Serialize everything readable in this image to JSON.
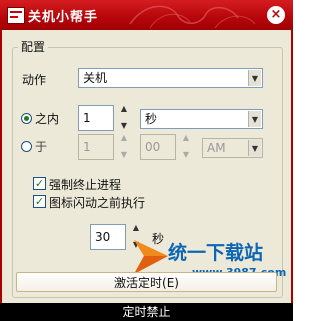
{
  "window": {
    "title": "关机小帮手",
    "close_glyph": "×"
  },
  "config": {
    "caption": "配置",
    "action": {
      "label": "动作",
      "value": "关机"
    },
    "within": {
      "label": "之内",
      "value": "1",
      "unit": "秒",
      "selected": true
    },
    "at": {
      "label": "于",
      "hour": "1",
      "minute": "00",
      "ampm": "AM",
      "selected": false
    },
    "options": [
      {
        "label": "强制终止进程",
        "checked": true
      },
      {
        "label": "图标闪动之前执行",
        "checked": true
      }
    ],
    "flash": {
      "value": "30",
      "unit": "秒"
    }
  },
  "buttons": {
    "activate": "激活定时(E)"
  },
  "status": {
    "text": "定时禁止"
  },
  "watermark": {
    "brand": "统一下载站",
    "url": "www.3987.com"
  },
  "icons": {
    "close": "close-icon",
    "dropdown": "chevron-down-icon",
    "spin_up": "arrow-up-icon",
    "spin_down": "arrow-down-icon"
  }
}
